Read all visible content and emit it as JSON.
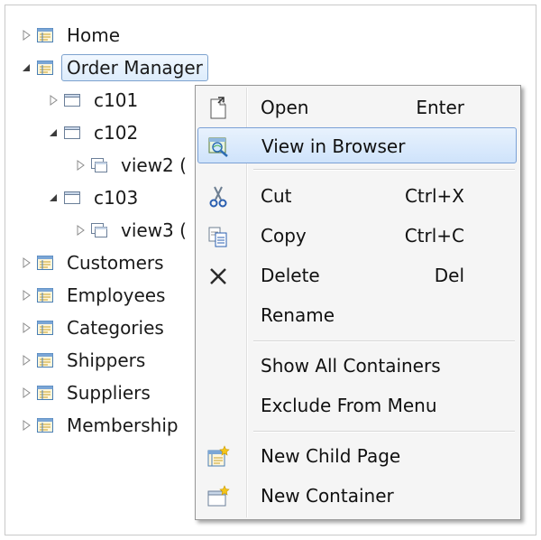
{
  "tree": {
    "items": [
      {
        "label": "Home",
        "icon": "page-icon",
        "expanded": false
      },
      {
        "label": "Order Manager",
        "icon": "page-icon",
        "expanded": true,
        "selected": true
      },
      {
        "label": "c101",
        "icon": "container-icon",
        "expanded": false
      },
      {
        "label": "c102",
        "icon": "container-icon",
        "expanded": true
      },
      {
        "label": "view2 (",
        "icon": "view-icon",
        "expanded": false
      },
      {
        "label": "c103",
        "icon": "container-icon",
        "expanded": true
      },
      {
        "label": "view3 (",
        "icon": "view-icon",
        "expanded": false
      },
      {
        "label": "Customers",
        "icon": "page-icon",
        "expanded": false
      },
      {
        "label": "Employees",
        "icon": "page-icon",
        "expanded": false
      },
      {
        "label": "Categories",
        "icon": "page-icon",
        "expanded": false
      },
      {
        "label": "Shippers",
        "icon": "page-icon",
        "expanded": false
      },
      {
        "label": "Suppliers",
        "icon": "page-icon",
        "expanded": false
      },
      {
        "label": "Membership",
        "icon": "page-icon",
        "expanded": false
      }
    ]
  },
  "menu": {
    "items": [
      {
        "label": "Open",
        "shortcut": "Enter",
        "icon": "open-document-icon"
      },
      {
        "label": "View in Browser",
        "shortcut": "",
        "icon": "view-in-browser-icon",
        "highlighted": true
      },
      {
        "label": "Cut",
        "shortcut": "Ctrl+X",
        "icon": "scissors-icon"
      },
      {
        "label": "Copy",
        "shortcut": "Ctrl+C",
        "icon": "copy-icon"
      },
      {
        "label": "Delete",
        "shortcut": "Del",
        "icon": "delete-x-icon"
      },
      {
        "label": "Rename",
        "shortcut": "",
        "icon": ""
      },
      {
        "label": "Show All Containers",
        "shortcut": "",
        "icon": ""
      },
      {
        "label": "Exclude From Menu",
        "shortcut": "",
        "icon": ""
      },
      {
        "label": "New Child Page",
        "shortcut": "",
        "icon": "new-child-page-icon"
      },
      {
        "label": "New Container",
        "shortcut": "",
        "icon": "new-container-icon"
      }
    ]
  },
  "colors": {
    "selection_fill": "#dcecfc",
    "selection_border": "#7da2ce",
    "menu_background": "#f5f5f5",
    "menu_hover_border": "#7ba1d6"
  }
}
